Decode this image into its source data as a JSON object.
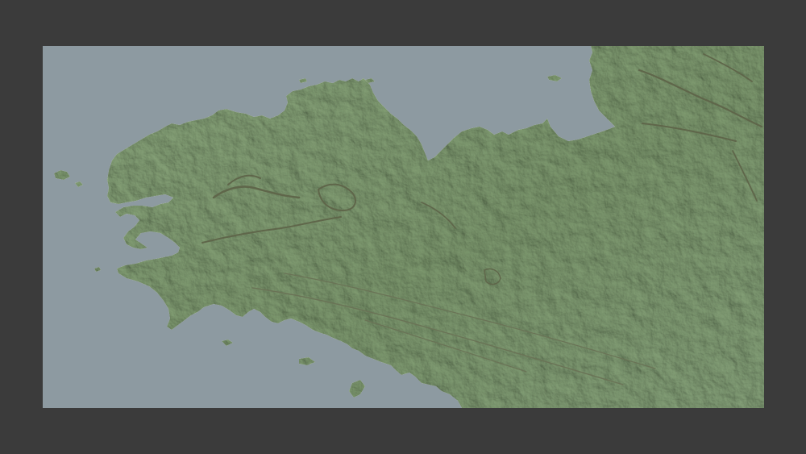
{
  "map": {
    "style": "shaded-relief",
    "colors": {
      "background": "#3b3b3b",
      "sea": "#8d9aa1",
      "land": "#7f9a6f",
      "land_highlight": "#93ad82",
      "relief_dark": "#5e6b4c",
      "ridge": "#6b6a4e"
    }
  }
}
